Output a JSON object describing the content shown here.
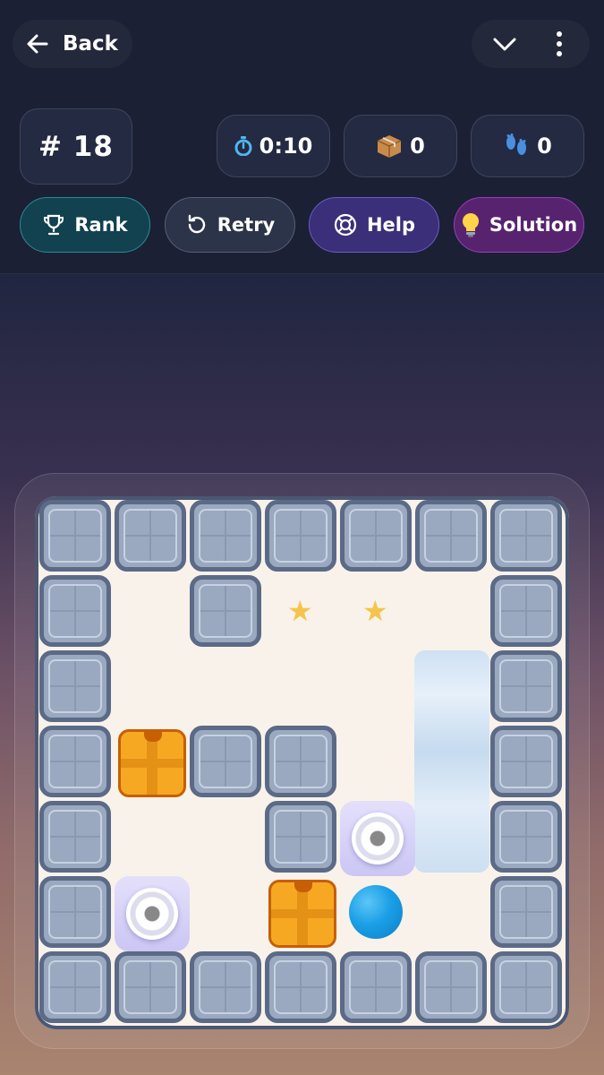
{
  "header": {
    "back_label": "Back",
    "level": "# 18",
    "timer": "0:10",
    "boxes": "0",
    "steps": "0"
  },
  "actions": {
    "rank": "Rank",
    "retry": "Retry",
    "help": "Help",
    "solution": "Solution"
  },
  "icons": {
    "back": "arrow-left-icon",
    "collapse": "chevron-down-icon",
    "more": "more-vertical-icon",
    "timer": "stopwatch-icon",
    "boxes": "package-icon",
    "steps": "footprints-icon",
    "rank": "trophy-icon",
    "retry": "rotate-icon",
    "help": "lifebuoy-icon",
    "solution": "lightbulb-icon"
  },
  "colors": {
    "rank_accent": "#2b8a9a",
    "help_accent": "#6b5cc4",
    "solution_accent": "#9640b6",
    "box": "#f7a823",
    "player": "#1b9fe6"
  }
}
